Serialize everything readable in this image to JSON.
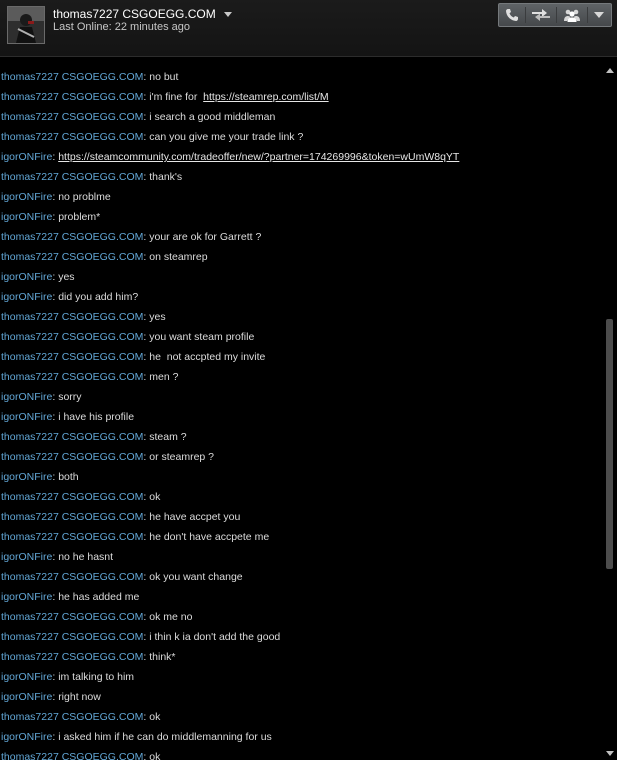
{
  "header": {
    "name": "thomas7227 CSGOEGG.COM",
    "status": "Last Online: 22 minutes ago",
    "buttons": {
      "call_icon": "phone-icon",
      "trade_icon": "trade-arrows-icon",
      "group_icon": "group-icon",
      "menu_icon": "chevron-down-icon"
    }
  },
  "colors": {
    "background": "#000000",
    "sender": "#62a7d6",
    "text": "#dcdcdc"
  },
  "messages": [
    {
      "sender": "thomas7227 CSGOEGG.COM",
      "text": "no but"
    },
    {
      "sender": "thomas7227 CSGOEGG.COM",
      "text": "i'm fine for  ",
      "link": "https://steamrep.com/list/M"
    },
    {
      "sender": "thomas7227 CSGOEGG.COM",
      "text": "i search a good middleman"
    },
    {
      "sender": "thomas7227 CSGOEGG.COM",
      "text": "can you give me your trade link ?"
    },
    {
      "sender": "igorONFire",
      "text": "",
      "link": "https://steamcommunity.com/tradeoffer/new/?partner=174269996&token=wUmW8qYT"
    },
    {
      "sender": "thomas7227 CSGOEGG.COM",
      "text": "thank's"
    },
    {
      "sender": "igorONFire",
      "text": "no problme"
    },
    {
      "sender": "igorONFire",
      "text": "problem*"
    },
    {
      "sender": "thomas7227 CSGOEGG.COM",
      "text": "your are ok for Garrett ?"
    },
    {
      "sender": "thomas7227 CSGOEGG.COM",
      "text": "on steamrep"
    },
    {
      "sender": "igorONFire",
      "text": "yes"
    },
    {
      "sender": "igorONFire",
      "text": "did you add him?"
    },
    {
      "sender": "thomas7227 CSGOEGG.COM",
      "text": "yes"
    },
    {
      "sender": "thomas7227 CSGOEGG.COM",
      "text": "you want steam profile"
    },
    {
      "sender": "thomas7227 CSGOEGG.COM",
      "text": "he  not accpted my invite"
    },
    {
      "sender": "thomas7227 CSGOEGG.COM",
      "text": "men ?"
    },
    {
      "sender": "igorONFire",
      "text": "sorry"
    },
    {
      "sender": "igorONFire",
      "text": "i have his profile"
    },
    {
      "sender": "thomas7227 CSGOEGG.COM",
      "text": "steam ?"
    },
    {
      "sender": "thomas7227 CSGOEGG.COM",
      "text": "or steamrep ?"
    },
    {
      "sender": "igorONFire",
      "text": "both"
    },
    {
      "sender": "thomas7227 CSGOEGG.COM",
      "text": "ok"
    },
    {
      "sender": "thomas7227 CSGOEGG.COM",
      "text": "he have accpet you"
    },
    {
      "sender": "thomas7227 CSGOEGG.COM",
      "text": "he don't have accpete me"
    },
    {
      "sender": "igorONFire",
      "text": "no he hasnt"
    },
    {
      "sender": "thomas7227 CSGOEGG.COM",
      "text": "ok you want change"
    },
    {
      "sender": "igorONFire",
      "text": "he has added me"
    },
    {
      "sender": "thomas7227 CSGOEGG.COM",
      "text": "ok me no"
    },
    {
      "sender": "thomas7227 CSGOEGG.COM",
      "text": "i thin k ia don't add the good"
    },
    {
      "sender": "thomas7227 CSGOEGG.COM",
      "text": "think*"
    },
    {
      "sender": "igorONFire",
      "text": "im talking to him"
    },
    {
      "sender": "igorONFire",
      "text": "right now"
    },
    {
      "sender": "thomas7227 CSGOEGG.COM",
      "text": "ok"
    },
    {
      "sender": "igorONFire",
      "text": "i asked him if he can do middlemanning for us"
    },
    {
      "sender": "thomas7227 CSGOEGG.COM",
      "text": "ok"
    }
  ]
}
